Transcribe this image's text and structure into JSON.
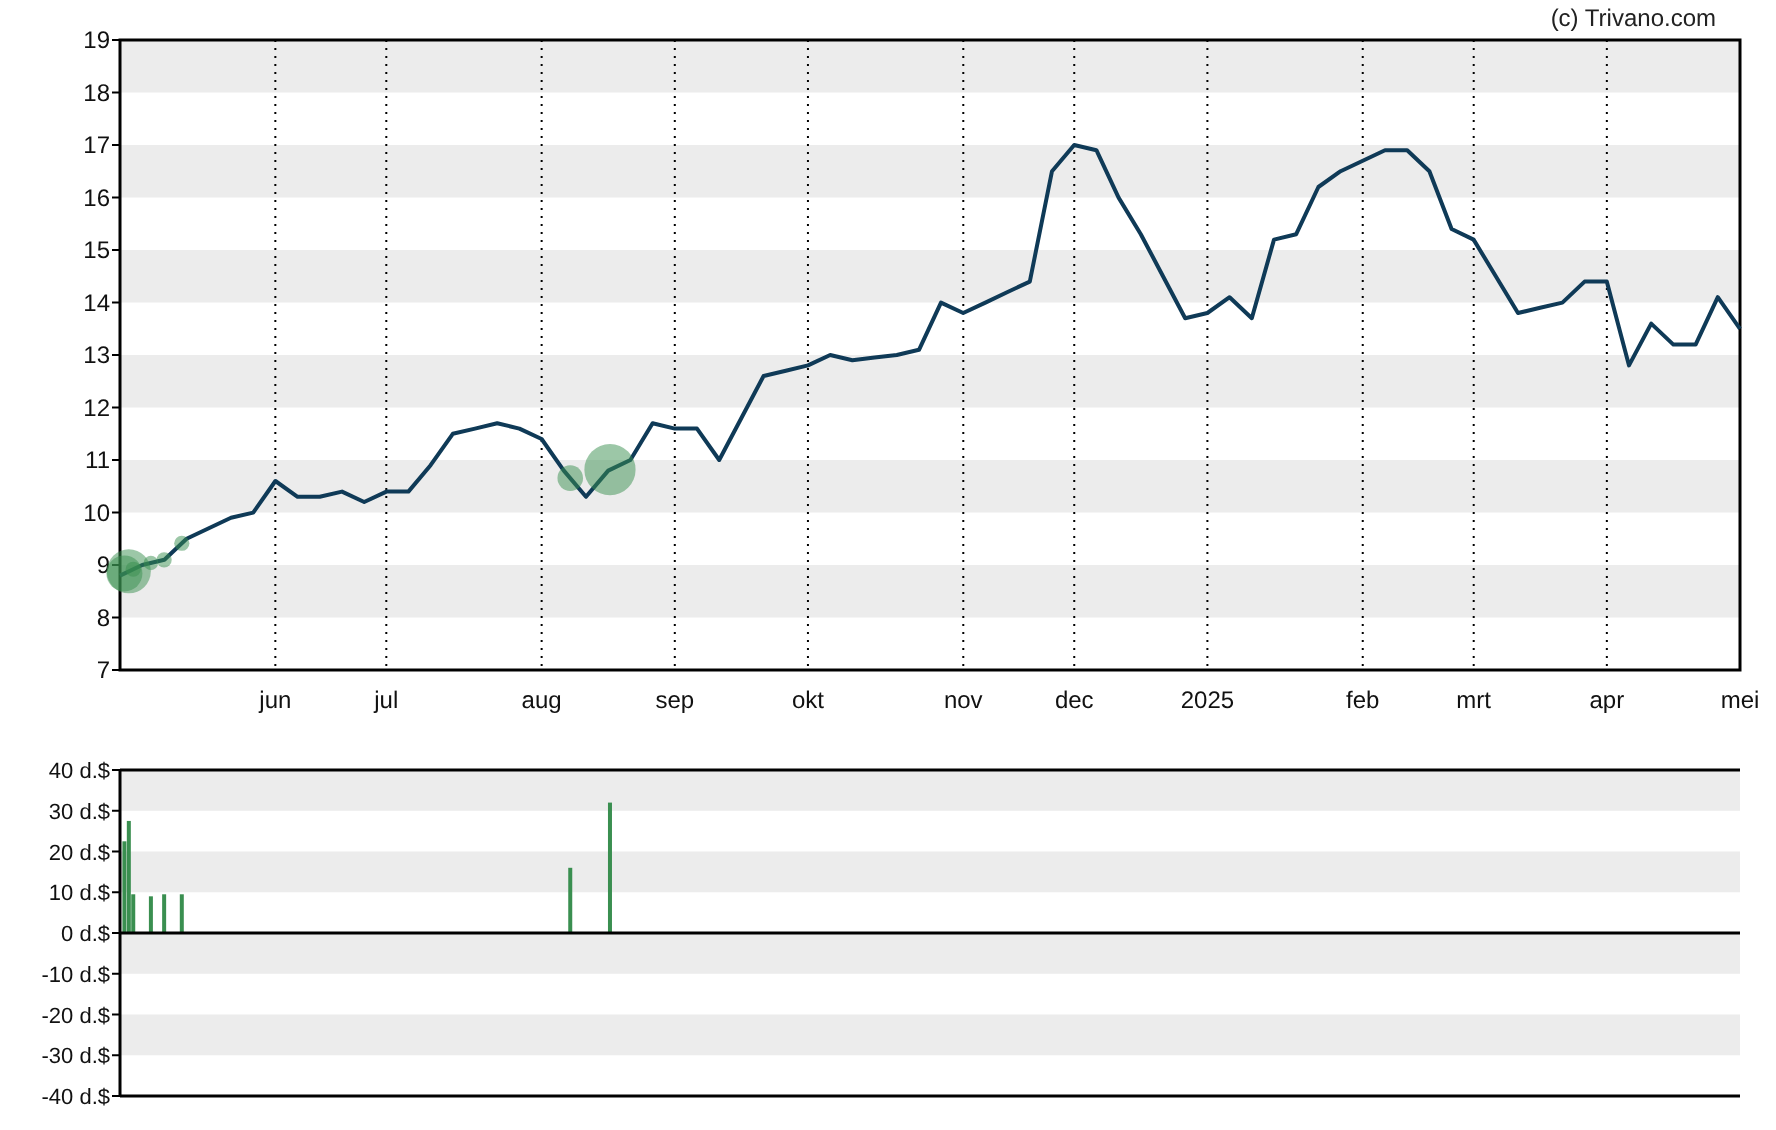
{
  "credit": "(c) Trivano.com",
  "price_chart": {
    "chart_data": {
      "type": "line",
      "grid": true,
      "ylim": [
        7,
        19
      ],
      "yticks": [
        7,
        8,
        9,
        10,
        11,
        12,
        13,
        14,
        15,
        16,
        17,
        18,
        19
      ],
      "categories": [
        null,
        null,
        null,
        null,
        null,
        null,
        null,
        "jun",
        null,
        null,
        null,
        null,
        "jul",
        null,
        null,
        null,
        null,
        null,
        null,
        "aug",
        null,
        null,
        null,
        null,
        null,
        "sep",
        null,
        null,
        null,
        null,
        null,
        "okt",
        null,
        null,
        null,
        null,
        null,
        null,
        "nov",
        null,
        null,
        null,
        null,
        "dec",
        null,
        null,
        null,
        null,
        null,
        "2025",
        null,
        null,
        null,
        null,
        null,
        null,
        "feb",
        null,
        null,
        null,
        null,
        "mrt",
        null,
        null,
        null,
        null,
        null,
        "apr",
        null,
        null,
        null,
        null,
        null,
        "mei"
      ],
      "series": [
        {
          "color": "#0f3a57",
          "values": [
            8.8,
            9.0,
            9.1,
            9.5,
            9.7,
            9.9,
            10.0,
            10.6,
            10.3,
            10.3,
            10.4,
            10.2,
            10.4,
            10.4,
            10.9,
            11.5,
            11.6,
            11.7,
            11.6,
            11.4,
            10.8,
            10.3,
            10.8,
            11.0,
            11.7,
            11.6,
            11.6,
            11.0,
            11.8,
            12.6,
            12.7,
            12.8,
            13.0,
            12.9,
            12.95,
            13.0,
            13.1,
            14.0,
            13.8,
            14.0,
            14.2,
            14.4,
            16.5,
            17.0,
            16.9,
            16.0,
            15.3,
            14.5,
            13.7,
            13.8,
            14.1,
            13.7,
            15.2,
            15.3,
            16.2,
            16.5,
            16.7,
            16.9,
            16.9,
            16.5,
            15.4,
            15.2,
            14.5,
            13.8,
            13.9,
            14.0,
            14.4,
            14.4,
            12.8,
            13.6,
            13.2,
            13.2,
            14.1,
            13.5
          ]
        }
      ]
    }
  },
  "trades_chart": {
    "chart_data": {
      "type": "bar",
      "grid": true,
      "ylim": [
        -40,
        40
      ],
      "yticks": [
        {
          "value": 40,
          "label": "40 d.$"
        },
        {
          "value": 30,
          "label": "30 d.$"
        },
        {
          "value": 20,
          "label": "20 d.$"
        },
        {
          "value": 10,
          "label": "10 d.$"
        },
        {
          "value": 0,
          "label": "0 d.$"
        },
        {
          "value": -10,
          "label": "-10 d.$"
        },
        {
          "value": -20,
          "label": "-20 d.$"
        },
        {
          "value": -30,
          "label": "-30 d.$"
        },
        {
          "value": -40,
          "label": "-40 d.$"
        }
      ],
      "categories": [
        null,
        null,
        null,
        null,
        null,
        null,
        null,
        null,
        null,
        null,
        null,
        null,
        null,
        null,
        null,
        null,
        null,
        null,
        null,
        null,
        null,
        null,
        null,
        null,
        null,
        null,
        null,
        null,
        null,
        null,
        null,
        null,
        null,
        null,
        null,
        null,
        null,
        null,
        null,
        null,
        null,
        null,
        null,
        null,
        null,
        null,
        null,
        null,
        null,
        null,
        null,
        null,
        null,
        null,
        null,
        null,
        null,
        null,
        null,
        null,
        null,
        null,
        null,
        null,
        null,
        null,
        null,
        null,
        null,
        null,
        null,
        null,
        null,
        null,
        null,
        null,
        null,
        null,
        null,
        null,
        null,
        null,
        null,
        null,
        null,
        null,
        null,
        null,
        null,
        null,
        null,
        null,
        null,
        null,
        null,
        null,
        null,
        null,
        null,
        null,
        null,
        null,
        null,
        null,
        null,
        null,
        null,
        null,
        null,
        null,
        null,
        null,
        null,
        null,
        null,
        null,
        null,
        null,
        null,
        null,
        null,
        null,
        null,
        null,
        null,
        null,
        null,
        null,
        null,
        null,
        null,
        null,
        null,
        null,
        null,
        null,
        null,
        null,
        null,
        null,
        null,
        null,
        null,
        null,
        null,
        null,
        null,
        null,
        null,
        null,
        null,
        null,
        null,
        null,
        null,
        null,
        null,
        null,
        null,
        null,
        null,
        null,
        null,
        null,
        null,
        null,
        null,
        null,
        null,
        null,
        null,
        null,
        null,
        null,
        null,
        null,
        null,
        null,
        null,
        null,
        null,
        null,
        null,
        null,
        null,
        null,
        null,
        null,
        null,
        null,
        null,
        null,
        null,
        null,
        null,
        null,
        null,
        null,
        null,
        null,
        null,
        null,
        null,
        null,
        null,
        null,
        null,
        null,
        null,
        null,
        null,
        null,
        null,
        null,
        null,
        null,
        null,
        null,
        null,
        null,
        null,
        null,
        null,
        null,
        null,
        null,
        null,
        null,
        null,
        null,
        null,
        null,
        null,
        null,
        null,
        null,
        null,
        null,
        null,
        null,
        null,
        null,
        null,
        null,
        null,
        null,
        null,
        null,
        null,
        null,
        null,
        null,
        null,
        null,
        null,
        null,
        null,
        null,
        null,
        null,
        null,
        null,
        null,
        null,
        null,
        null,
        null,
        null,
        null,
        null,
        null,
        null,
        null,
        null,
        null,
        null,
        null,
        null,
        null,
        null,
        null,
        null,
        null,
        null,
        null,
        null,
        null,
        null,
        null,
        null,
        null,
        null,
        null,
        null,
        null,
        null,
        null,
        null,
        null,
        null,
        null,
        null,
        null,
        null,
        null,
        null,
        null,
        null,
        null,
        null,
        null,
        null,
        null,
        null,
        null,
        null,
        null,
        null,
        null,
        null,
        null,
        null,
        null,
        null,
        null,
        null,
        null,
        null,
        null,
        null,
        null,
        null,
        null,
        null,
        null,
        null,
        null,
        null,
        null,
        null,
        null,
        null,
        null,
        null,
        null,
        null,
        null,
        null,
        null,
        null,
        null,
        null,
        null,
        null,
        null,
        null,
        null,
        null,
        null,
        null,
        null,
        null,
        null,
        null,
        null,
        null,
        null,
        null
      ],
      "series": [
        {
          "color": "#3a8f50",
          "values": [
            null,
            22.5,
            27.5,
            9.5,
            null,
            null,
            null,
            9,
            null,
            null,
            9.5,
            null,
            null,
            null,
            9.5,
            null,
            null,
            null,
            null,
            null,
            null,
            null,
            null,
            null,
            null,
            null,
            null,
            null,
            null,
            null,
            null,
            null,
            null,
            null,
            null,
            null,
            null,
            null,
            null,
            null,
            null,
            null,
            null,
            null,
            null,
            null,
            null,
            null,
            null,
            null,
            null,
            null,
            null,
            null,
            null,
            null,
            null,
            null,
            null,
            null,
            null,
            null,
            null,
            null,
            null,
            null,
            null,
            null,
            null,
            null,
            null,
            null,
            null,
            null,
            null,
            null,
            null,
            null,
            null,
            null,
            null,
            null,
            null,
            null,
            null,
            null,
            null,
            null,
            null,
            null,
            null,
            null,
            null,
            null,
            null,
            null,
            null,
            null,
            null,
            null,
            null,
            null,
            16,
            null,
            null,
            null,
            null,
            null,
            null,
            null,
            null,
            32,
            null,
            null,
            null,
            null,
            null,
            null,
            null,
            null,
            null,
            null,
            null,
            null,
            null,
            null,
            null,
            null,
            null,
            null,
            null,
            null,
            null,
            null,
            null,
            null,
            null,
            null,
            null,
            null,
            null,
            null,
            null,
            null,
            null,
            null,
            null,
            null,
            null,
            null,
            null,
            null,
            null,
            null,
            null,
            null,
            null,
            null,
            null,
            null,
            null,
            null,
            null,
            null,
            null,
            null,
            null,
            null,
            null,
            null,
            null,
            null,
            null,
            null,
            null,
            null,
            null,
            null,
            null,
            null,
            null,
            null,
            null,
            null,
            null,
            null,
            null,
            null,
            null,
            null,
            null,
            null,
            null,
            null,
            null,
            null,
            null,
            null,
            null,
            null,
            null,
            null,
            null,
            null,
            null,
            null,
            null,
            null,
            null,
            null,
            null,
            null,
            null,
            null,
            null,
            null,
            null,
            null,
            null,
            null,
            null,
            null,
            null,
            null,
            null,
            null,
            null,
            null,
            null,
            null,
            null,
            null,
            null,
            null,
            null,
            null,
            null,
            null,
            null,
            null,
            null,
            null,
            null,
            null,
            null,
            null,
            null,
            null,
            null,
            null,
            null,
            null,
            null,
            null,
            null,
            null,
            null,
            null,
            null,
            null,
            null,
            null,
            null,
            null,
            null,
            null,
            null,
            null,
            null,
            null,
            null,
            null,
            null,
            null,
            null,
            null,
            null,
            null,
            null,
            null,
            null,
            null,
            null,
            null,
            null,
            null,
            null,
            null,
            null,
            null,
            null,
            null,
            null,
            null,
            null,
            null,
            null,
            null,
            null,
            null,
            null,
            null,
            null,
            null,
            null,
            null,
            null,
            null,
            null,
            null,
            null,
            null,
            null,
            null,
            null,
            null,
            null,
            null,
            null,
            null,
            null,
            null,
            null,
            null,
            null,
            null,
            null,
            null,
            null,
            null,
            null,
            null,
            null,
            null,
            null,
            null,
            null,
            null,
            null,
            null,
            null,
            null,
            null,
            null,
            null,
            null,
            null,
            null,
            null,
            null,
            null,
            null,
            null,
            null,
            null,
            null,
            null,
            null,
            null,
            null,
            null,
            null,
            null,
            null,
            null,
            null,
            null,
            null
          ]
        }
      ]
    }
  }
}
